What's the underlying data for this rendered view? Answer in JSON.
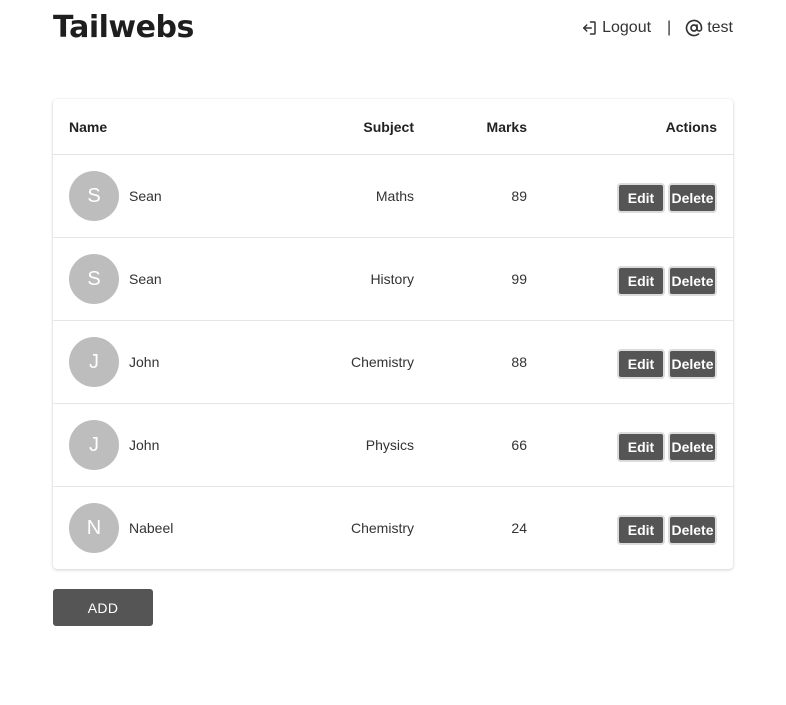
{
  "header": {
    "brand": "Tailwebs",
    "logout_label": "Logout",
    "separator": "|",
    "username": "test"
  },
  "table": {
    "columns": {
      "name": "Name",
      "subject": "Subject",
      "marks": "Marks",
      "actions": "Actions"
    },
    "rows": [
      {
        "initial": "S",
        "name": "Sean",
        "subject": "Maths",
        "marks": "89",
        "edit": "Edit",
        "delete": "Delete"
      },
      {
        "initial": "S",
        "name": "Sean",
        "subject": "History",
        "marks": "99",
        "edit": "Edit",
        "delete": "Delete"
      },
      {
        "initial": "J",
        "name": "John",
        "subject": "Chemistry",
        "marks": "88",
        "edit": "Edit",
        "delete": "Delete"
      },
      {
        "initial": "J",
        "name": "John",
        "subject": "Physics",
        "marks": "66",
        "edit": "Edit",
        "delete": "Delete"
      },
      {
        "initial": "N",
        "name": "Nabeel",
        "subject": "Chemistry",
        "marks": "24",
        "edit": "Edit",
        "delete": "Delete"
      }
    ]
  },
  "add_label": "ADD",
  "icons": {
    "logout": "logout-icon",
    "user": "at-sign-icon"
  },
  "colors": {
    "button_bg": "#555555",
    "avatar_bg": "#bdbdbd"
  }
}
